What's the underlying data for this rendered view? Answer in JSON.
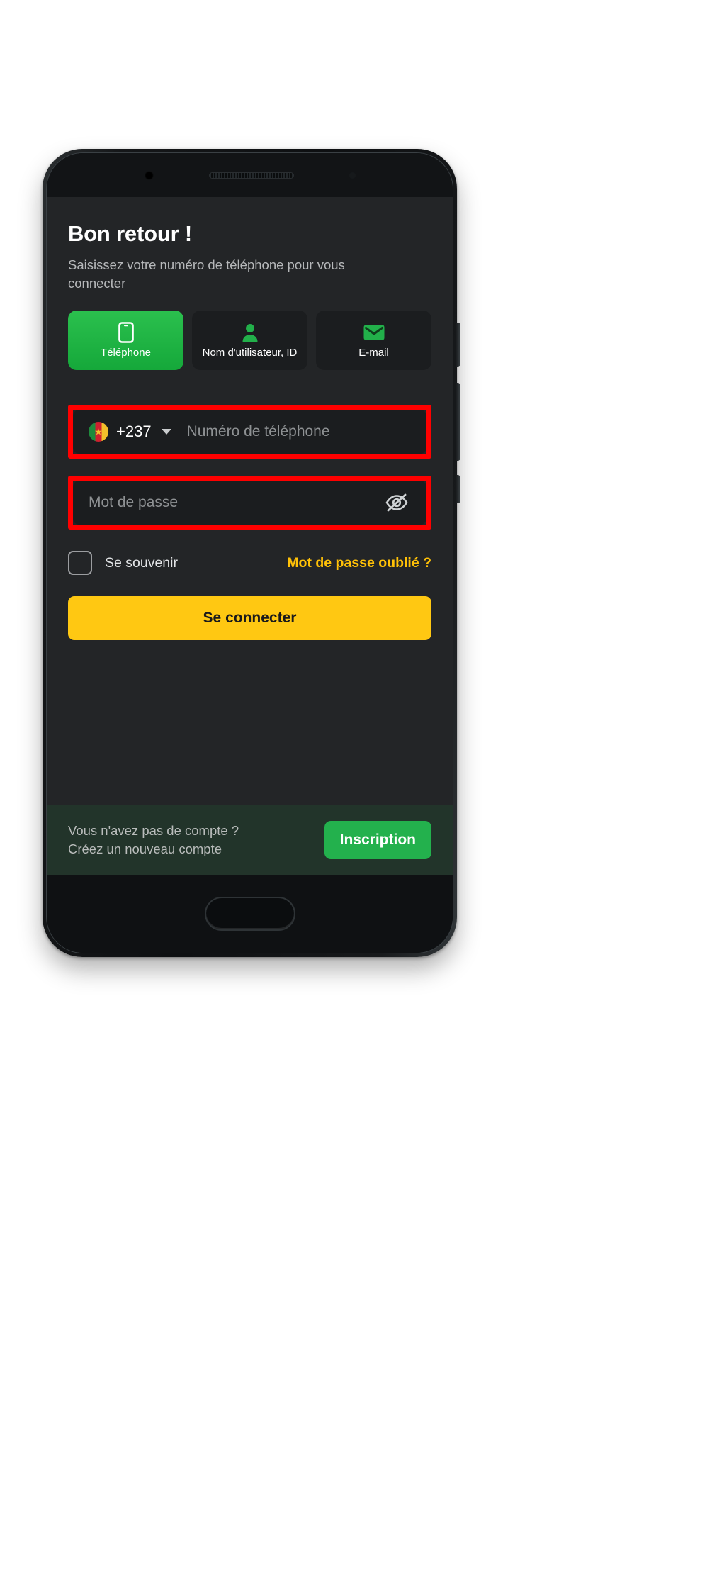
{
  "screen": {
    "title": "Bon retour !",
    "subtitle": "Saisissez votre numéro de téléphone pour vous connecter",
    "tabs": [
      {
        "label": "Téléphone",
        "icon": "phone-icon",
        "active": true
      },
      {
        "label": "Nom d'utilisateur, ID",
        "icon": "user-icon",
        "active": false
      },
      {
        "label": "E-mail",
        "icon": "envelope-icon",
        "active": false
      }
    ],
    "phone_field": {
      "country_code": "+237",
      "flag": "cameroon-flag-icon",
      "caret": "chevron-down-icon",
      "placeholder": "Numéro de téléphone",
      "value": "",
      "highlighted": true
    },
    "password_field": {
      "placeholder": "Mot de passe",
      "value": "",
      "toggle_icon": "eye-off-icon",
      "highlighted": true
    },
    "remember": {
      "label": "Se souvenir",
      "checked": false
    },
    "forgot_password": "Mot de passe oublié ?",
    "login_button": "Se connecter",
    "signup": {
      "line1": "Vous n'avez pas de compte ?",
      "line2": "Créez un nouveau compte",
      "button": "Inscription"
    }
  },
  "colors": {
    "accent_green": "#23b14d",
    "accent_yellow": "#ffc812",
    "highlight_red": "#ff0000",
    "screen_bg": "#232527",
    "field_bg": "#1b1d1f",
    "signup_bar_bg": "#22342a"
  }
}
